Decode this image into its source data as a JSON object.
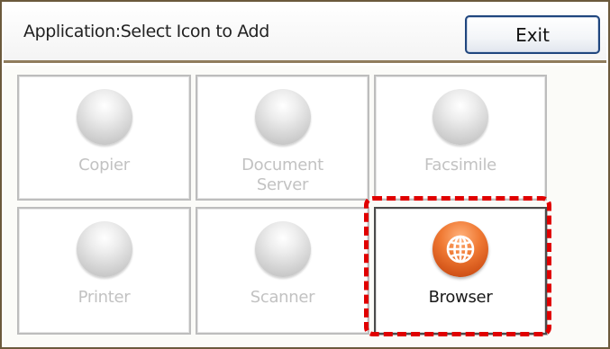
{
  "header": {
    "title": "Application:Select Icon to Add",
    "exit_label": "Exit"
  },
  "apps": [
    {
      "label_lines": [
        "Copier"
      ],
      "state": "disabled",
      "icon": "blank-circle-icon"
    },
    {
      "label_lines": [
        "Document",
        "Server"
      ],
      "state": "disabled",
      "icon": "blank-circle-icon"
    },
    {
      "label_lines": [
        "Facsimile"
      ],
      "state": "disabled",
      "icon": "blank-circle-icon"
    },
    {
      "label_lines": [
        "Printer"
      ],
      "state": "disabled",
      "icon": "blank-circle-icon"
    },
    {
      "label_lines": [
        "Scanner"
      ],
      "state": "disabled",
      "icon": "blank-circle-icon"
    },
    {
      "label_lines": [
        "Browser"
      ],
      "state": "enabled",
      "icon": "globe-icon"
    }
  ],
  "colors": {
    "highlight": "#e00000",
    "browser_icon": "#e8692a",
    "disabled_text": "#c2c2c2",
    "exit_border": "#20467e"
  }
}
